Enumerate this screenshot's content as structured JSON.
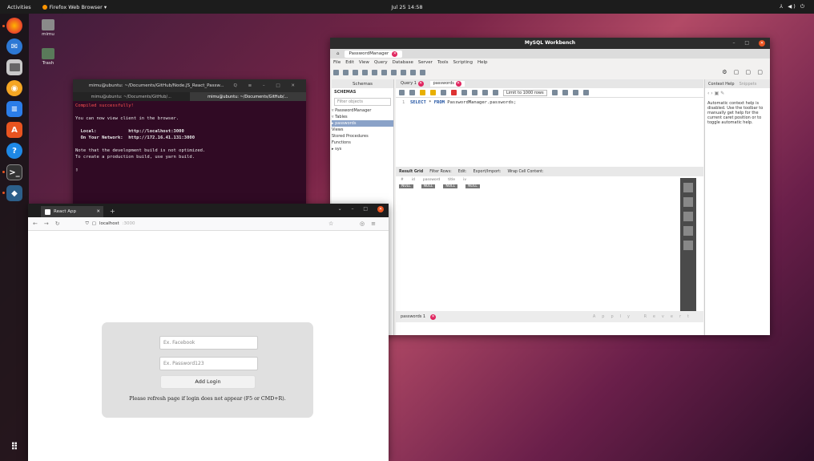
{
  "topbar": {
    "activities": "Activities",
    "app_menu": "Firefox Web Browser ▾",
    "clock": "Jul 25  14:58",
    "tray": "⅄ ◀) ⏻"
  },
  "desktop": {
    "home_label": "mimu",
    "trash_label": "Trash"
  },
  "terminal": {
    "title": "mimu@ubuntu: ~/Documents/GitHub/Node.JS_React_Passw...",
    "tab1": "mimu@ubuntu: ~/Documents/GitHub/...",
    "tab2": "mimu@ubuntu: ~/Documents/GitHub/...",
    "lines": [
      "Compiled successfully!",
      "",
      "You can now view client in the browser.",
      "",
      "  Local:            http://localhost:3000",
      "  On Your Network:  http://172.16.41.131:3000",
      "",
      "Note that the development build is not optimized.",
      "To create a production build, use yarn build.",
      "",
      "▯"
    ]
  },
  "workbench": {
    "title": "MySQL Workbench",
    "conn_tab": "PasswordManager",
    "menu": [
      "File",
      "Edit",
      "View",
      "Query",
      "Database",
      "Server",
      "Tools",
      "Scripting",
      "Help"
    ],
    "schemas_tab": "Schemas",
    "schemas_heading": "SCHEMAS",
    "filter": "Filter objects",
    "tree": [
      "▿ PasswordManager",
      "  ▿ Tables",
      "    ▸ passwords",
      "    Views",
      "    Stored Procedures",
      "    Functions",
      "▸ sys"
    ],
    "query_tab": "Query 1",
    "passwords_tab": "passwords",
    "limit": "Limit to 1000 rows",
    "sql_line": "1",
    "sql_kw1": "SELECT",
    "sql_mid": " * ",
    "sql_kw2": "FROM",
    "sql_rest": " PasswordManager.passwords;",
    "result_grid": "Result Grid",
    "filter_rows": "Filter Rows:",
    "edit": "Edit:",
    "export": "Export/Import:",
    "wrap": "Wrap Cell Content:",
    "cols": [
      "#",
      "id",
      "password",
      "title",
      "iv"
    ],
    "row": [
      "NULL",
      "NULL",
      "NULL",
      "NULL"
    ],
    "bottom_tab": "passwords 1",
    "apply": "Apply",
    "revert": "Revert",
    "context_help": "Context Help",
    "snippets": "Snippets",
    "help_text": "Automatic context help is disabled. Use the toolbar to manually get help for the current caret position or to toggle automatic help."
  },
  "browser": {
    "tab_title": "React App",
    "url_host": "localhost",
    "url_port": ":3000",
    "site_placeholder": "Ex. Facebook",
    "password_placeholder": "Ex. Password123",
    "add_button": "Add Login",
    "hint": "Please refresh page if login does not appear (F5 or CMD+R)."
  }
}
